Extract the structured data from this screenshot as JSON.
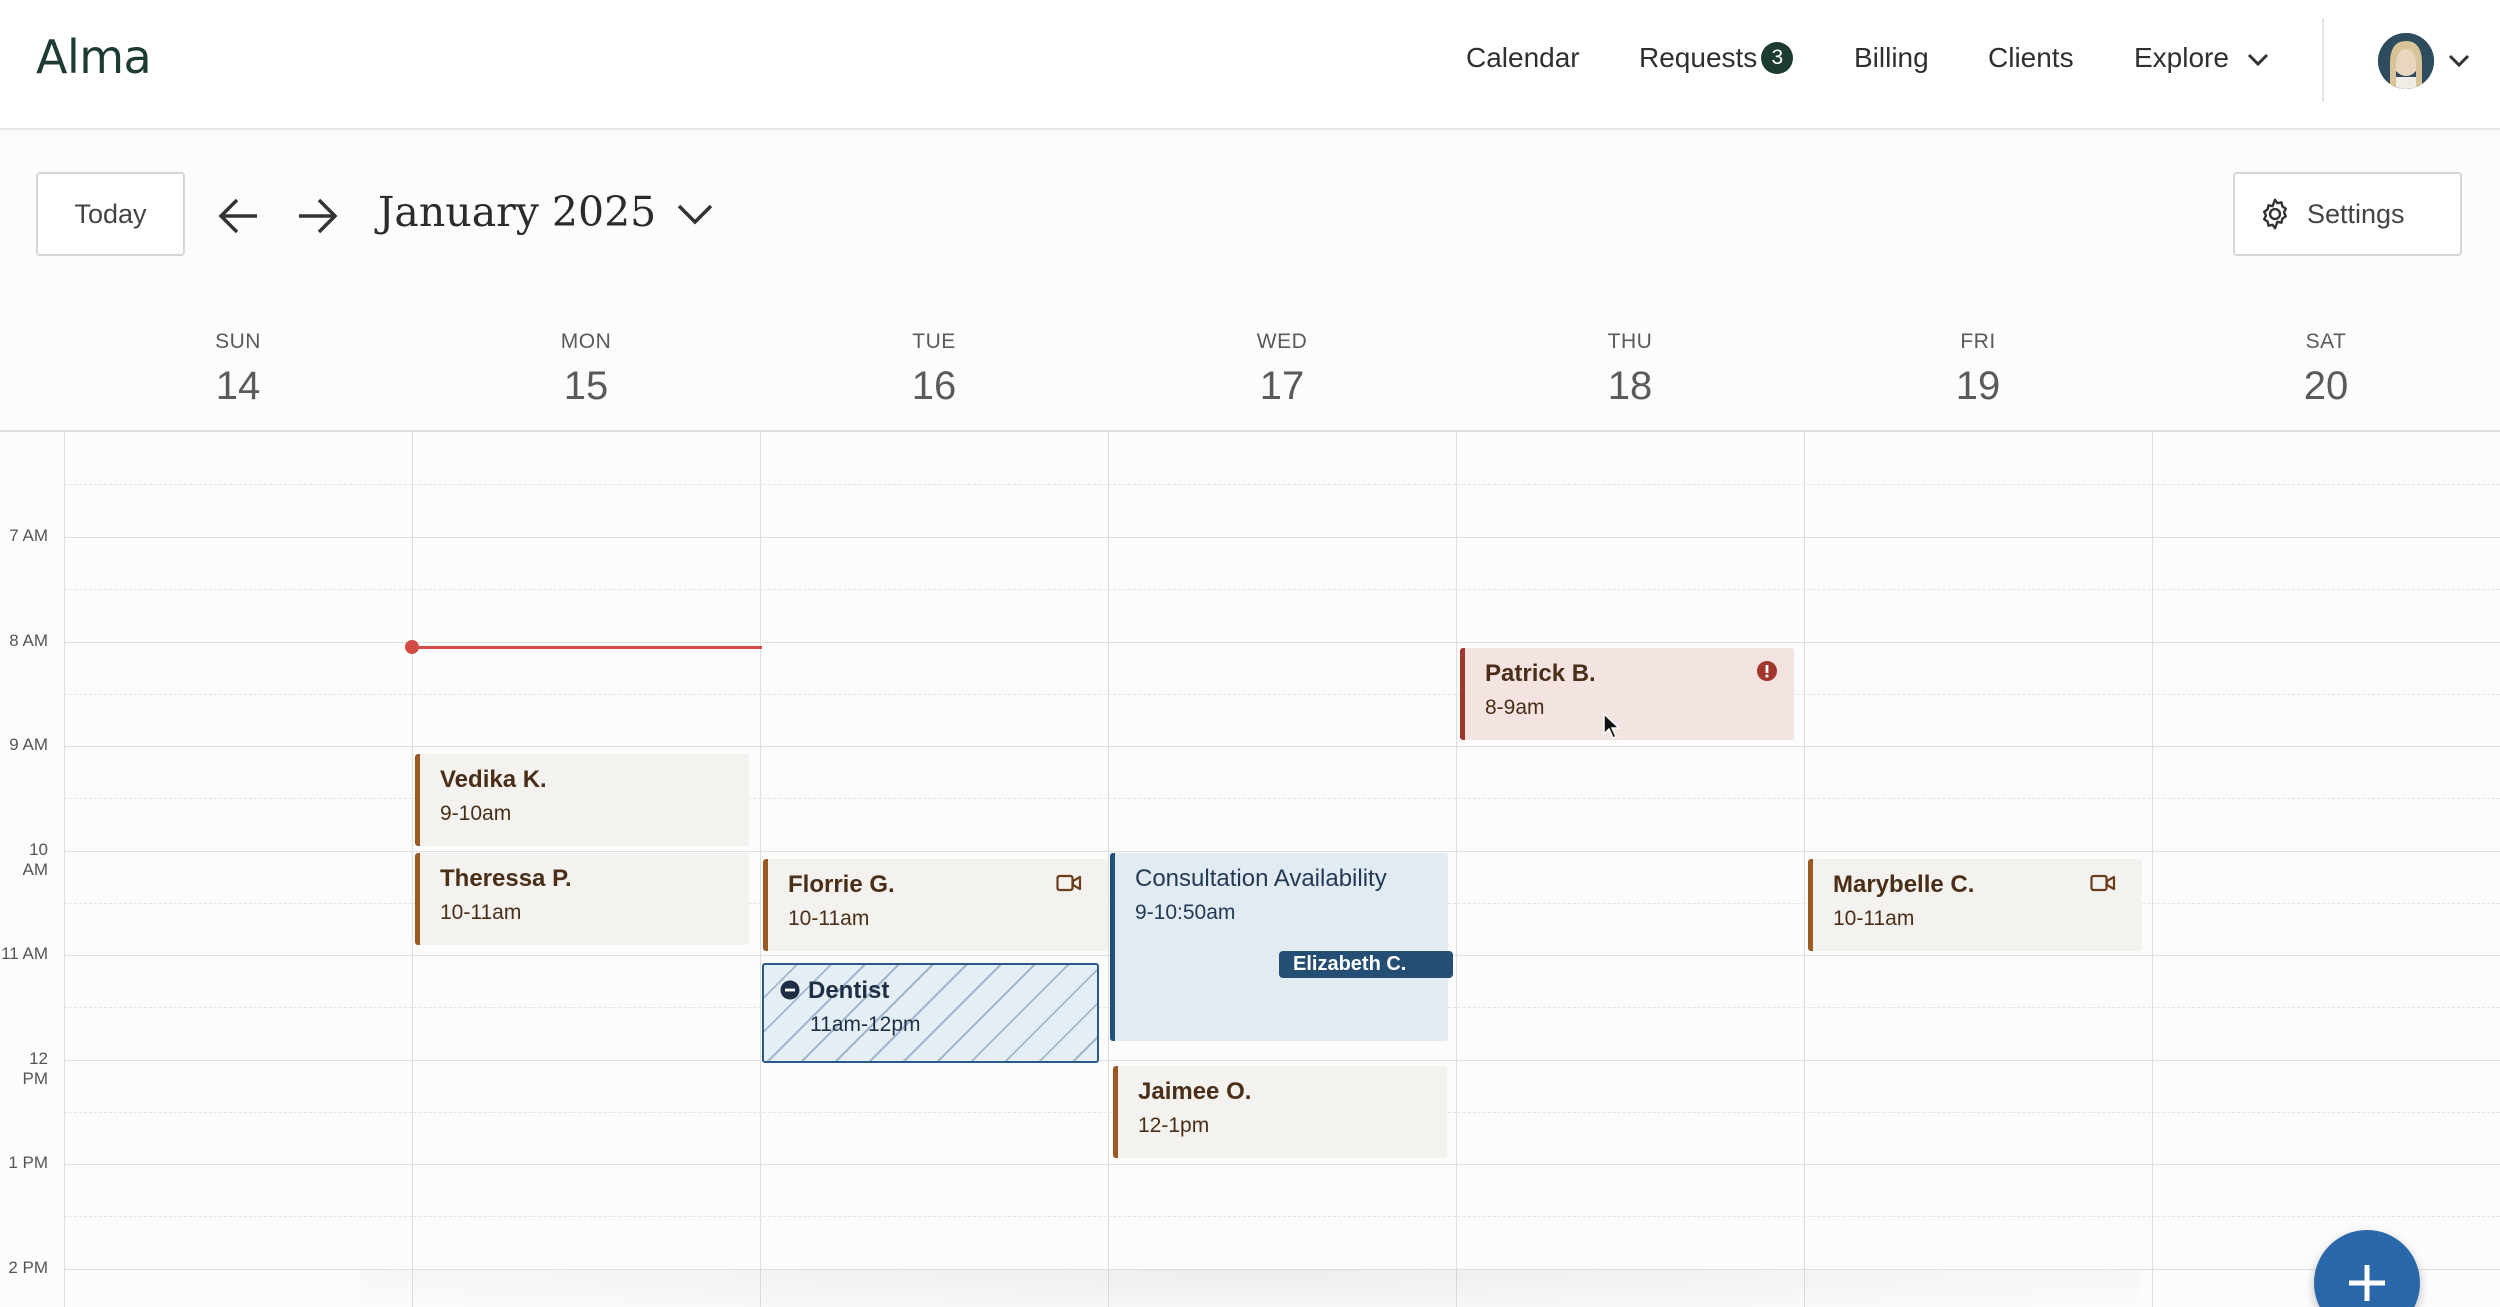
{
  "app": {
    "logo": "Alma"
  },
  "nav": {
    "calendar": "Calendar",
    "requests": "Requests",
    "requests_count": "3",
    "billing": "Billing",
    "clients": "Clients",
    "explore": "Explore"
  },
  "toolbar": {
    "today": "Today",
    "month_label": "January 2025",
    "settings": "Settings"
  },
  "days": [
    {
      "name": "SUN",
      "num": "14"
    },
    {
      "name": "MON",
      "num": "15"
    },
    {
      "name": "TUE",
      "num": "16"
    },
    {
      "name": "WED",
      "num": "17"
    },
    {
      "name": "THU",
      "num": "18"
    },
    {
      "name": "FRI",
      "num": "19"
    },
    {
      "name": "SAT",
      "num": "20"
    }
  ],
  "time_labels": [
    "7 AM",
    "8 AM",
    "9 AM",
    "10 AM",
    "11 AM",
    "12 PM",
    "1 PM",
    "2 PM"
  ],
  "events": {
    "patrick": {
      "name": "Patrick B.",
      "time": "8-9am"
    },
    "vedika": {
      "name": "Vedika K.",
      "time": "9-10am"
    },
    "theressa": {
      "name": "Theressa P.",
      "time": "10-11am"
    },
    "florrie": {
      "name": "Florrie G.",
      "time": "10-11am"
    },
    "dentist": {
      "name": "Dentist",
      "time": "11am-12pm"
    },
    "consultation": {
      "name": "Consultation Availability",
      "time": "9-10:50am",
      "tag": "Elizabeth C."
    },
    "jaimee": {
      "name": "Jaimee O.",
      "time": "12-1pm"
    },
    "marybelle": {
      "name": "Marybelle C.",
      "time": "10-11am"
    }
  },
  "colors": {
    "brand": "#1d3b34",
    "session_accent": "#9a5a22",
    "alert_accent": "#a0362e",
    "consult_accent": "#1f4f7a",
    "now_line": "#d24b45",
    "fab": "#2a67a8"
  }
}
